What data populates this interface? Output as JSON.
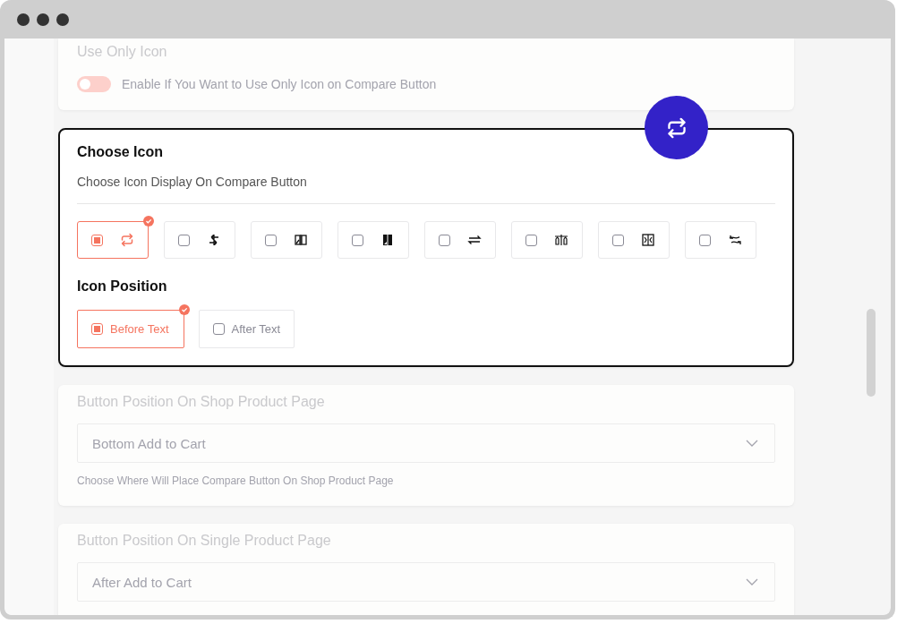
{
  "use_only_icon": {
    "title": "Use Only Icon",
    "toggle": {
      "on": false,
      "label": "Enable If You Want to Use Only Icon on Compare Button"
    }
  },
  "choose_icon": {
    "title": "Choose Icon",
    "description": "Choose Icon Display On Compare Button",
    "icons": [
      {
        "selected": true
      },
      {
        "selected": false
      },
      {
        "selected": false
      },
      {
        "selected": false
      },
      {
        "selected": false
      },
      {
        "selected": false
      },
      {
        "selected": false
      },
      {
        "selected": false
      }
    ],
    "position_title": "Icon Position",
    "positions": [
      {
        "label": "Before Text",
        "selected": true
      },
      {
        "label": "After Text",
        "selected": false
      }
    ]
  },
  "shop_position": {
    "title": "Button Position On Shop Product Page",
    "value": "Bottom Add to Cart",
    "help": "Choose Where Will Place Compare Button On Shop Product Page"
  },
  "single_position": {
    "title": "Button Position On Single Product Page",
    "value": "After Add to Cart"
  }
}
